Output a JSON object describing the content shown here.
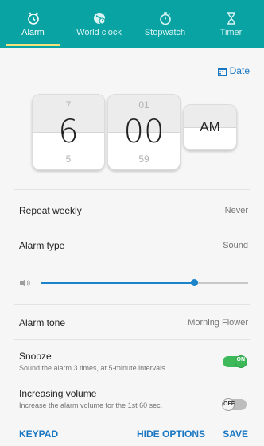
{
  "tabs": [
    {
      "label": "Alarm",
      "icon": "alarm-clock-icon",
      "active": true
    },
    {
      "label": "World clock",
      "icon": "globe-clock-icon",
      "active": false
    },
    {
      "label": "Stopwatch",
      "icon": "stopwatch-icon",
      "active": false
    },
    {
      "label": "Timer",
      "icon": "hourglass-icon",
      "active": false
    }
  ],
  "date_button": {
    "label": "Date",
    "icon": "calendar-icon"
  },
  "time_picker": {
    "hour": {
      "above": "7",
      "value": "6",
      "below": "5"
    },
    "minute": {
      "above": "01",
      "value": "00",
      "below": "59"
    },
    "ampm": {
      "value": "AM"
    }
  },
  "settings": {
    "repeat": {
      "label": "Repeat weekly",
      "value": "Never"
    },
    "alarm_type": {
      "label": "Alarm type",
      "value": "Sound"
    },
    "volume": {
      "level": 0.74,
      "icon": "speaker-icon"
    },
    "alarm_tone": {
      "label": "Alarm tone",
      "value": "Morning Flower"
    },
    "snooze": {
      "label": "Snooze",
      "description": "Sound the alarm 3 times, at 5-minute intervals.",
      "state": "ON"
    },
    "increasing_volume": {
      "label": "Increasing volume",
      "description": "Increase the alarm volume for the 1st 60 sec.",
      "state": "OFF"
    }
  },
  "bottom_bar": {
    "keypad": "KEYPAD",
    "hide_options": "HIDE OPTIONS",
    "save": "SAVE"
  },
  "colors": {
    "accent": "#0aa3a3",
    "link": "#1977c2",
    "toggle_on": "#3db95a",
    "slider": "#1b83c9"
  }
}
